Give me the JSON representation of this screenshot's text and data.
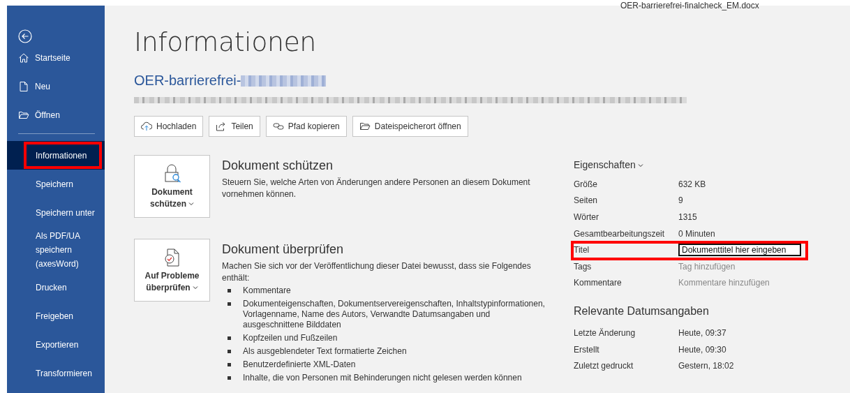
{
  "window": {
    "file_name": "OER-barrierefrei-finalcheck_EM.docx"
  },
  "sidebar": {
    "nav_items": [
      {
        "label": "Startseite",
        "selected": false
      },
      {
        "label": "Neu",
        "selected": false
      },
      {
        "label": "Öffnen",
        "selected": false
      }
    ],
    "items": [
      {
        "label": "Informationen",
        "selected": true,
        "highlighted": true
      },
      {
        "label": "Speichern",
        "selected": false,
        "highlighted": false
      },
      {
        "label": "Speichern unter",
        "selected": false,
        "highlighted": false
      },
      {
        "label": "Als PDF/UA speichern (axesWord)",
        "selected": false,
        "highlighted": false
      },
      {
        "label": "Drucken",
        "selected": false,
        "highlighted": false
      },
      {
        "label": "Freigeben",
        "selected": false,
        "highlighted": false
      },
      {
        "label": "Exportieren",
        "selected": false,
        "highlighted": false
      },
      {
        "label": "Transformieren",
        "selected": false,
        "highlighted": false
      }
    ]
  },
  "page": {
    "title": "Informationen",
    "doc_name": "OER-barrierefrei-",
    "actions": [
      "Hochladen",
      "Teilen",
      "Pfad kopieren",
      "Dateispeicherort öffnen"
    ]
  },
  "sections": [
    {
      "button_label": "Dokument schützen",
      "heading": "Dokument schützen",
      "description": "Steuern Sie, welche Arten von Änderungen andere Personen an diesem Dokument vornehmen können."
    },
    {
      "button_label": "Auf Probleme überprüfen",
      "heading": "Dokument überprüfen",
      "description": "Machen Sie sich vor der Veröffentlichung dieser Datei bewusst, dass sie Folgendes enthält:",
      "bullets": [
        "Kommentare",
        "Dokumenteigenschaften, Dokumentservereigenschaften, Inhaltstypinformationen, Vorlagenname, Name des Autors, Verwandte Datumsangaben und ausgeschnittene Bilddaten",
        "Kopfzeilen und Fußzeilen",
        "Als ausgeblendeter Text formatierte Zeichen",
        "Benutzerdefinierte XML-Daten",
        "Inhalte, die von Personen mit Behinderungen nicht gelesen werden können"
      ]
    }
  ],
  "properties": {
    "heading": "Eigenschaften",
    "rows": [
      {
        "label": "Größe",
        "value": "632 KB",
        "kind": "text",
        "highlighted": false
      },
      {
        "label": "Seiten",
        "value": "9",
        "kind": "text",
        "highlighted": false
      },
      {
        "label": "Wörter",
        "value": "1315",
        "kind": "text",
        "highlighted": false
      },
      {
        "label": "Gesamtbearbeitungszeit",
        "value": "0 Minuten",
        "kind": "text",
        "highlighted": false
      },
      {
        "label": "Titel",
        "value": "Dokumenttitel hier eingeben",
        "kind": "field",
        "highlighted": true
      },
      {
        "label": "Tags",
        "value": "Tag hinzufügen",
        "kind": "hint",
        "highlighted": false
      },
      {
        "label": "Kommentare",
        "value": "Kommentare hinzufügen",
        "kind": "hint",
        "highlighted": false
      }
    ]
  },
  "dates": {
    "heading": "Relevante Datumsangaben",
    "rows": [
      {
        "label": "Letzte Änderung",
        "value": "Heute, 09:37"
      },
      {
        "label": "Erstellt",
        "value": "Heute, 09:30"
      },
      {
        "label": "Zuletzt gedruckt",
        "value": "Gestern, 18:02"
      }
    ]
  }
}
